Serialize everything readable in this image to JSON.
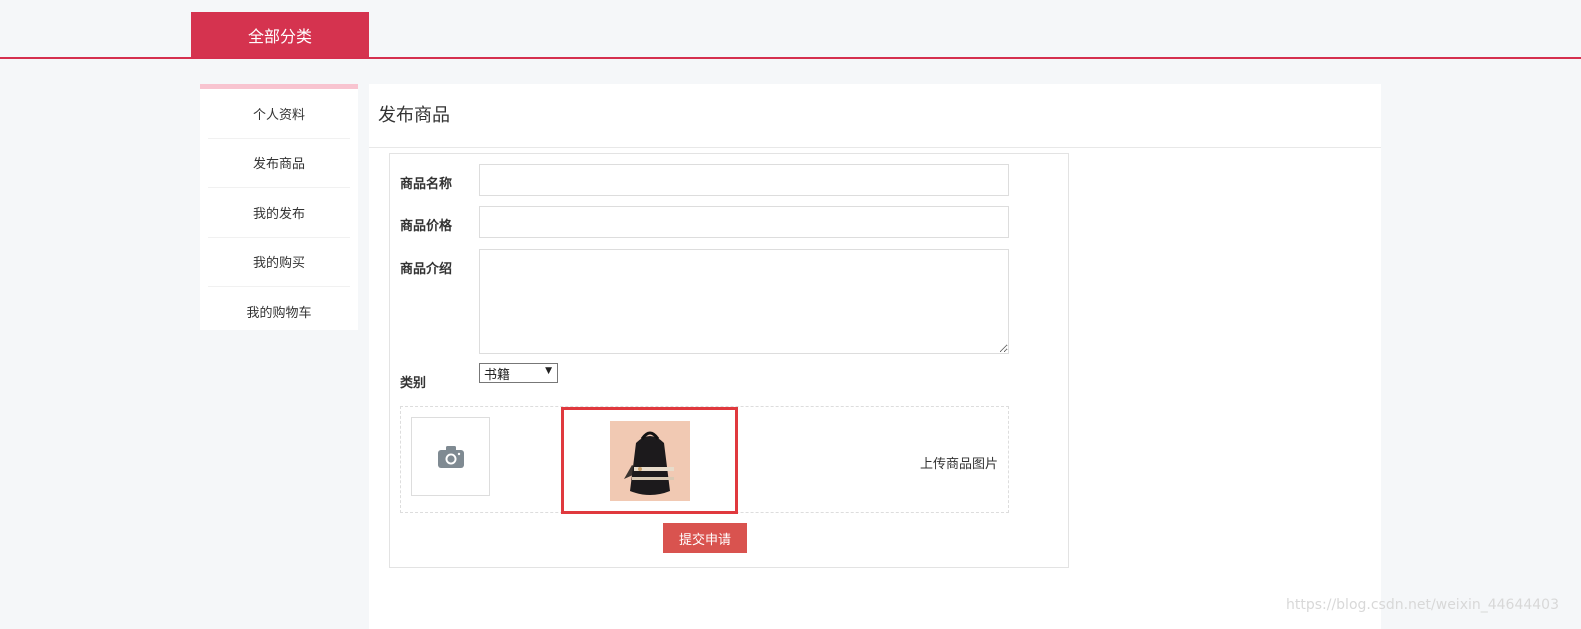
{
  "header": {
    "category_tab": "全部分类"
  },
  "sidebar": {
    "items": [
      {
        "label": "个人资料"
      },
      {
        "label": "发布商品"
      },
      {
        "label": "我的发布"
      },
      {
        "label": "我的购买"
      },
      {
        "label": "我的购物车"
      }
    ]
  },
  "main": {
    "title": "发布商品",
    "form": {
      "name_label": "商品名称",
      "name_value": "",
      "price_label": "商品价格",
      "price_value": "",
      "intro_label": "商品介绍",
      "intro_value": "",
      "category_label": "类别",
      "category_selected": "书籍",
      "upload_label": "上传商品图片",
      "submit_label": "提交申请"
    }
  },
  "icons": {
    "upload": "camera-icon",
    "select": "dropdown-arrow-icon"
  },
  "colors": {
    "accent": "#d5334f",
    "submit": "#d9534f",
    "highlight": "#e0393e"
  },
  "watermark": "https://blog.csdn.net/weixin_44644403"
}
